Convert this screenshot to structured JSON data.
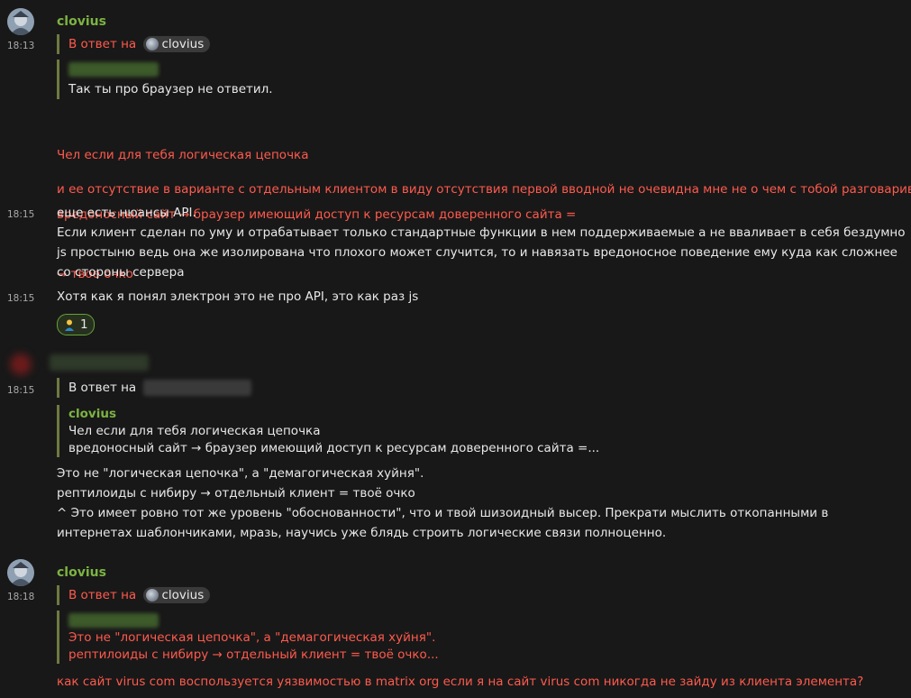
{
  "colors": {
    "sender": "#7cb342",
    "highlight": "#ff5a4d",
    "background": "#181818"
  },
  "icons": {
    "reaction_emoji": "person-shrug-emoji"
  },
  "messages": [
    {
      "sender": "clovius",
      "time": "18:13",
      "reply_prefix": "В ответ на",
      "reply_to": "clovius",
      "quoted_text": "Так ты про браузер не ответил.",
      "body_lines": [
        "Чел если для тебя логическая цепочка",
        "вредоносный сайт → браузер имеющий доступ к ресурсам доверенного сайта =",
        "→ твое очко"
      ],
      "body2": "и ее отсутствие в варианте с отдельным клиентом в виду отсутствия первой вводной не очевидна мне не о чем с тобой разговаривать"
    },
    {
      "time": "18:15",
      "text": "еще есть нюансы API.\nЕсли клиент сделан по уму и отрабатывает только стандартные функции в нем поддерживаемые а не вваливает в себя бездумно js простыню ведь она же изолирована что плохого может случится, то и навязать вредоносное поведение ему куда как сложнее со стороны сервера"
    },
    {
      "time": "18:15",
      "text": "Хотя как я понял электрон это не про API, это как раз js",
      "reaction_count": "1"
    },
    {
      "time": "18:15",
      "reply_prefix": "В ответ на",
      "quoted_sender": "clovius",
      "quoted_lines": [
        "Чел если для тебя логическая цепочка",
        "вредоносный сайт → браузер имеющий доступ к ресурсам доверенного сайта =..."
      ],
      "text": "Это не \"логическая цепочка\", а \"демагогическая хуйня\".\nрептилоиды с нибиру → отдельный клиент = твоё очко\n^ Это имеет ровно тот же уровень \"обоснованности\", что и твой шизоидный высер. Прекрати мыслить откопанными в интернетах шаблончиками, мразь, научись уже блядь строить логические связи полноценно."
    },
    {
      "sender": "clovius",
      "time": "18:18",
      "reply_prefix": "В ответ на",
      "reply_to": "clovius",
      "quoted_lines": [
        "Это не \"логическая цепочка\", а \"демагогическая хуйня\".",
        "рептилоиды с нибиру → отдельный клиент = твоё очко..."
      ],
      "body": "как сайт virus com воспользуется уязвимостью в matrix org если я на сайт virus com никогда не зайду из клиента элемента?"
    }
  ]
}
